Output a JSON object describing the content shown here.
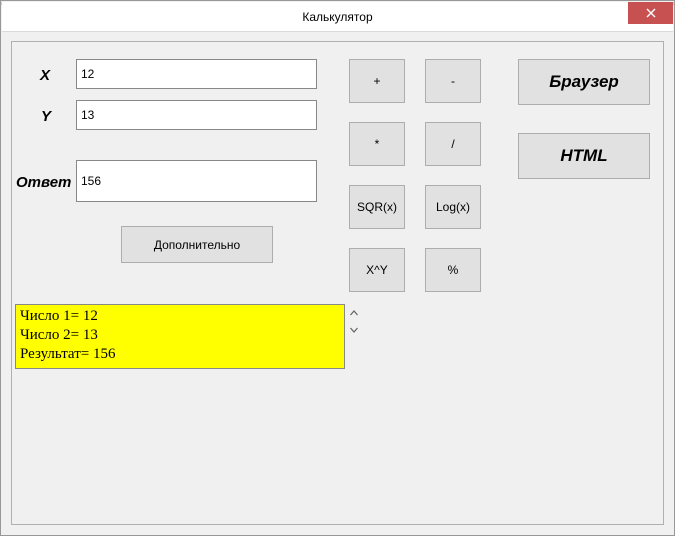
{
  "window": {
    "title": "Калькулятор"
  },
  "labels": {
    "x": "X",
    "y": "Y",
    "answer": "Ответ"
  },
  "inputs": {
    "x": "12",
    "y": "13",
    "answer": "156"
  },
  "buttons": {
    "extra": "Дополнительно",
    "plus": "+",
    "minus": "-",
    "mul": "*",
    "div": "/",
    "sqr": "SQR(x)",
    "log": "Log(x)",
    "pow": "X^Y",
    "pct": "%",
    "browser": "Браузер",
    "html": "HTML"
  },
  "log": {
    "text": "Число 1= 12\nЧисло 2= 13\nРезультат= 156"
  }
}
